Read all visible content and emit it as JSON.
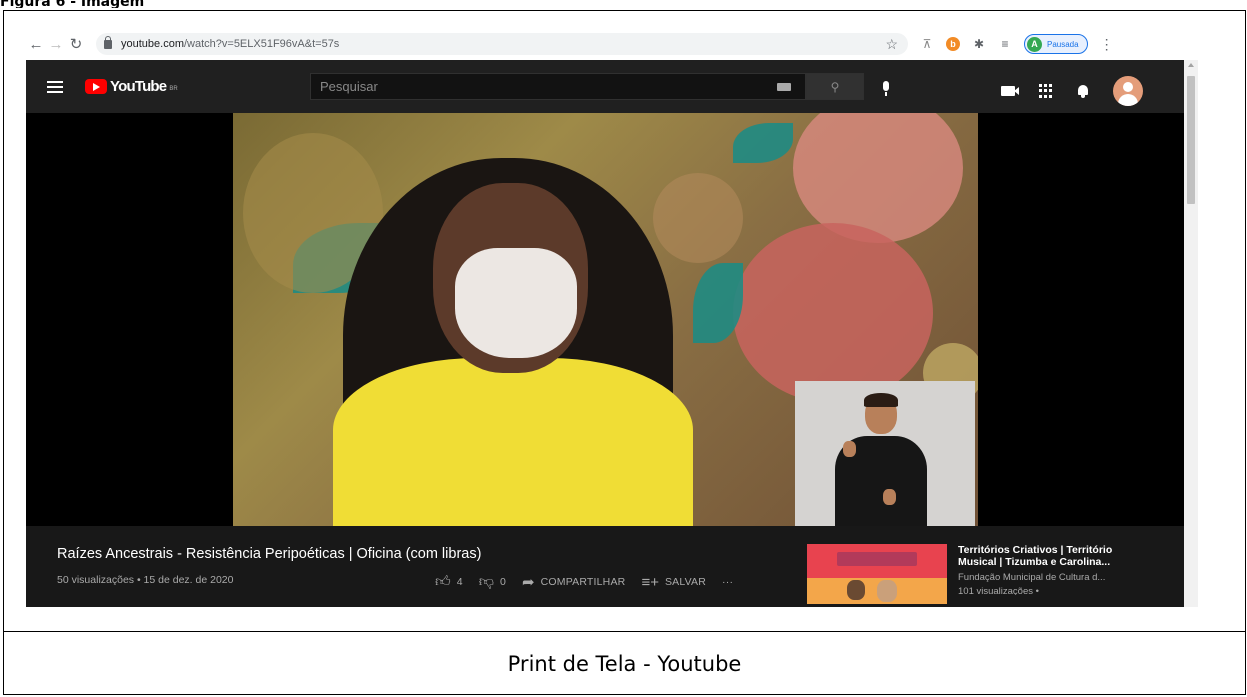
{
  "figure": {
    "label": "Figura 6 - Imagem",
    "caption": "Print de Tela - Youtube"
  },
  "browser": {
    "url_domain": "youtube.com",
    "url_path": "/watch?v=5ELX51F96vA&t=57s",
    "profile_initial": "A",
    "profile_label": "Pausada",
    "icons": [
      "back-arrow-icon",
      "forward-arrow-icon",
      "reload-icon",
      "lock-icon",
      "bookmark-star-icon",
      "extension-pin-icon",
      "extension-b-icon",
      "puzzle-icon",
      "reading-list-icon",
      "menu-dots-icon"
    ]
  },
  "youtube": {
    "logo_text": "YouTube",
    "logo_region": "BR",
    "search_placeholder": "Pesquisar",
    "video": {
      "title": "Raízes Ancestrais - Resistência Peripoéticas | Oficina (com libras)",
      "meta": "50 visualizações • 15 de dez. de 2020",
      "likes": "4",
      "dislikes": "0",
      "share_label": "COMPARTILHAR",
      "save_label": "SALVAR",
      "more_label": "···"
    },
    "recommendation": {
      "title": "Territórios Criativos | Território Musical | Tizumba e Carolina...",
      "channel": "Fundação Municipal de Cultura d...",
      "views": "101 visualizações •"
    },
    "colors": {
      "masthead": "#202020",
      "background": "#181818",
      "logo_red": "#ff0000"
    }
  }
}
